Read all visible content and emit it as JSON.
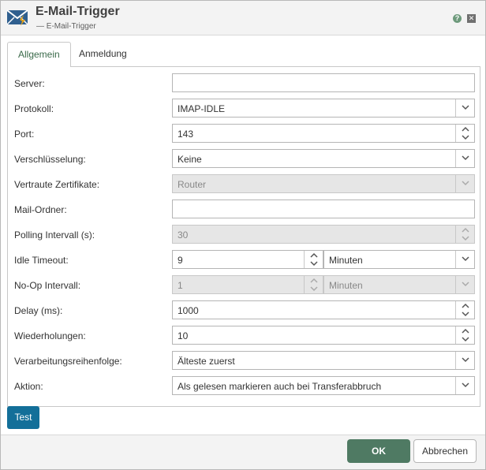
{
  "window": {
    "title": "E-Mail-Trigger",
    "subtitle": "— E-Mail-Trigger",
    "help_glyph": "?",
    "close_glyph": "✕"
  },
  "tabs": [
    {
      "label": "Allgemein",
      "active": true
    },
    {
      "label": "Anmeldung",
      "active": false
    }
  ],
  "form": {
    "server": {
      "label": "Server:",
      "value": ""
    },
    "protocol": {
      "label": "Protokoll:",
      "value": "IMAP-IDLE"
    },
    "port": {
      "label": "Port:",
      "value": "143"
    },
    "encryption": {
      "label": "Verschlüsselung:",
      "value": "Keine"
    },
    "trusted_certs": {
      "label": "Vertraute Zertifikate:",
      "value": "Router"
    },
    "mail_folder": {
      "label": "Mail-Ordner:",
      "value": ""
    },
    "polling_interval": {
      "label": "Polling Intervall (s):",
      "value": "30"
    },
    "idle_timeout": {
      "label": "Idle Timeout:",
      "value": "9",
      "unit": "Minuten"
    },
    "noop_interval": {
      "label": "No-Op Intervall:",
      "value": "1",
      "unit": "Minuten"
    },
    "delay": {
      "label": "Delay (ms):",
      "value": "1000"
    },
    "retries": {
      "label": "Wiederholungen:",
      "value": "10"
    },
    "processing_order": {
      "label": "Verarbeitungsreihenfolge:",
      "value": "Älteste zuerst"
    },
    "action": {
      "label": "Aktion:",
      "value": "Als gelesen markieren auch bei Transferabbruch"
    }
  },
  "buttons": {
    "test": "Test",
    "ok": "OK",
    "cancel": "Abbrechen"
  },
  "colors": {
    "primary_button": "#4f7a63",
    "test_button": "#136f99"
  }
}
